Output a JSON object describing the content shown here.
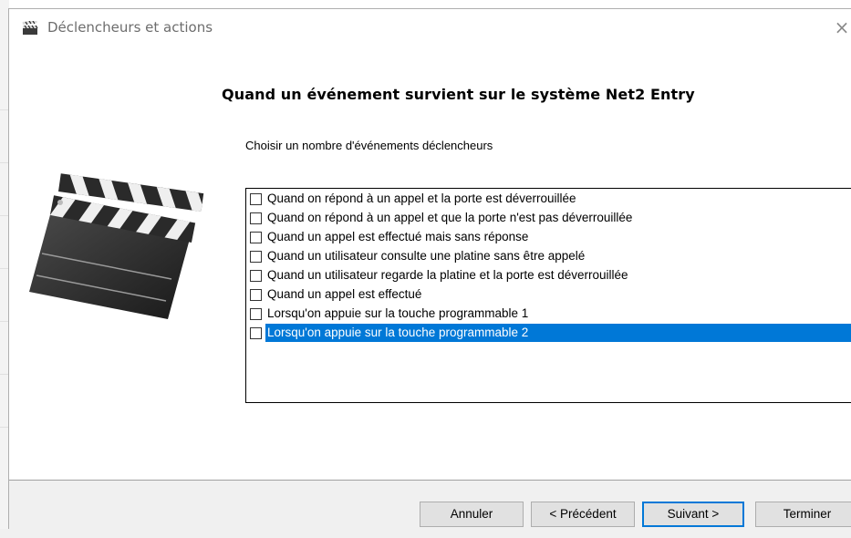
{
  "window": {
    "title": "Déclencheurs et actions",
    "close_glyph": "×",
    "title_icon": "clapperboard-icon"
  },
  "page": {
    "heading": "Quand un événement survient sur le système Net2 Entry",
    "subheading": "Choisir un nombre d'événements déclencheurs",
    "illustration": "clapperboard-icon"
  },
  "triggers": [
    {
      "label": "Quand on répond à un appel et la porte est déverrouillée",
      "checked": false,
      "selected": false
    },
    {
      "label": "Quand on répond à un appel et que la porte n'est pas déverrouillée",
      "checked": false,
      "selected": false
    },
    {
      "label": "Quand un appel est effectué mais sans réponse",
      "checked": false,
      "selected": false
    },
    {
      "label": "Quand un utilisateur consulte une platine sans être appelé",
      "checked": false,
      "selected": false
    },
    {
      "label": "Quand un utilisateur regarde la platine et la porte est déverrouillée",
      "checked": false,
      "selected": false
    },
    {
      "label": "Quand un appel est effectué",
      "checked": false,
      "selected": false
    },
    {
      "label": "Lorsqu'on appuie sur la touche programmable 1",
      "checked": false,
      "selected": false
    },
    {
      "label": "Lorsqu'on appuie sur la touche programmable 2",
      "checked": false,
      "selected": true
    }
  ],
  "buttons": {
    "cancel": "Annuler",
    "previous": "< Précédent",
    "next": "Suivant >",
    "finish": "Terminer"
  },
  "colors": {
    "selection": "#0078d7",
    "default_button_border": "#0078d7",
    "footer_background": "#f0f0f0"
  }
}
